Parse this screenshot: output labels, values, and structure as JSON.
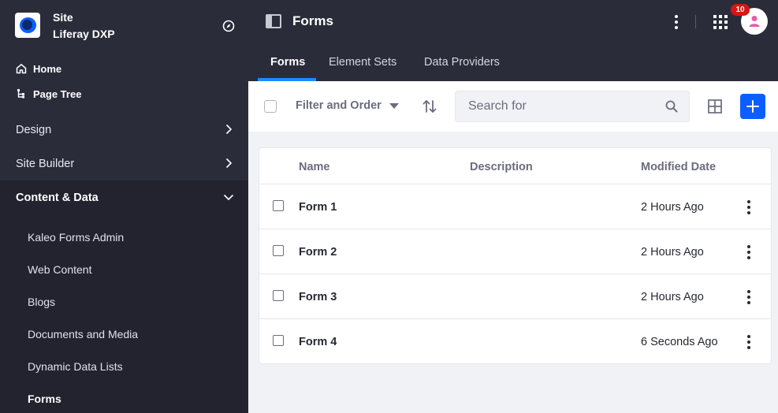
{
  "sidebar": {
    "site_kicker": "Site",
    "site_name": "Liferay DXP",
    "home_label": "Home",
    "page_tree_label": "Page Tree",
    "sections": [
      {
        "label": "Design"
      },
      {
        "label": "Site Builder"
      },
      {
        "label": "Content & Data"
      }
    ],
    "content_items": [
      {
        "label": "Kaleo Forms Admin"
      },
      {
        "label": "Web Content"
      },
      {
        "label": "Blogs"
      },
      {
        "label": "Documents and Media"
      },
      {
        "label": "Dynamic Data Lists"
      },
      {
        "label": "Forms"
      }
    ]
  },
  "header": {
    "title": "Forms",
    "notification_count": "10"
  },
  "tabs": [
    {
      "label": "Forms"
    },
    {
      "label": "Element Sets"
    },
    {
      "label": "Data Providers"
    }
  ],
  "toolbar": {
    "filter_label": "Filter and Order",
    "search_placeholder": "Search for"
  },
  "table": {
    "columns": [
      "Name",
      "Description",
      "Modified Date"
    ],
    "rows": [
      {
        "name": "Form 1",
        "description": "",
        "modified": "2 Hours Ago"
      },
      {
        "name": "Form 2",
        "description": "",
        "modified": "2 Hours Ago"
      },
      {
        "name": "Form 3",
        "description": "",
        "modified": "2 Hours Ago"
      },
      {
        "name": "Form 4",
        "description": "",
        "modified": "6 Seconds Ago"
      }
    ]
  },
  "colors": {
    "sidebar_bg": "#2b2c3a",
    "accent": "#0b5fff",
    "tab_underline": "#1a8cff",
    "badge": "#da1414",
    "avatar_icon": "#e95ba7"
  }
}
